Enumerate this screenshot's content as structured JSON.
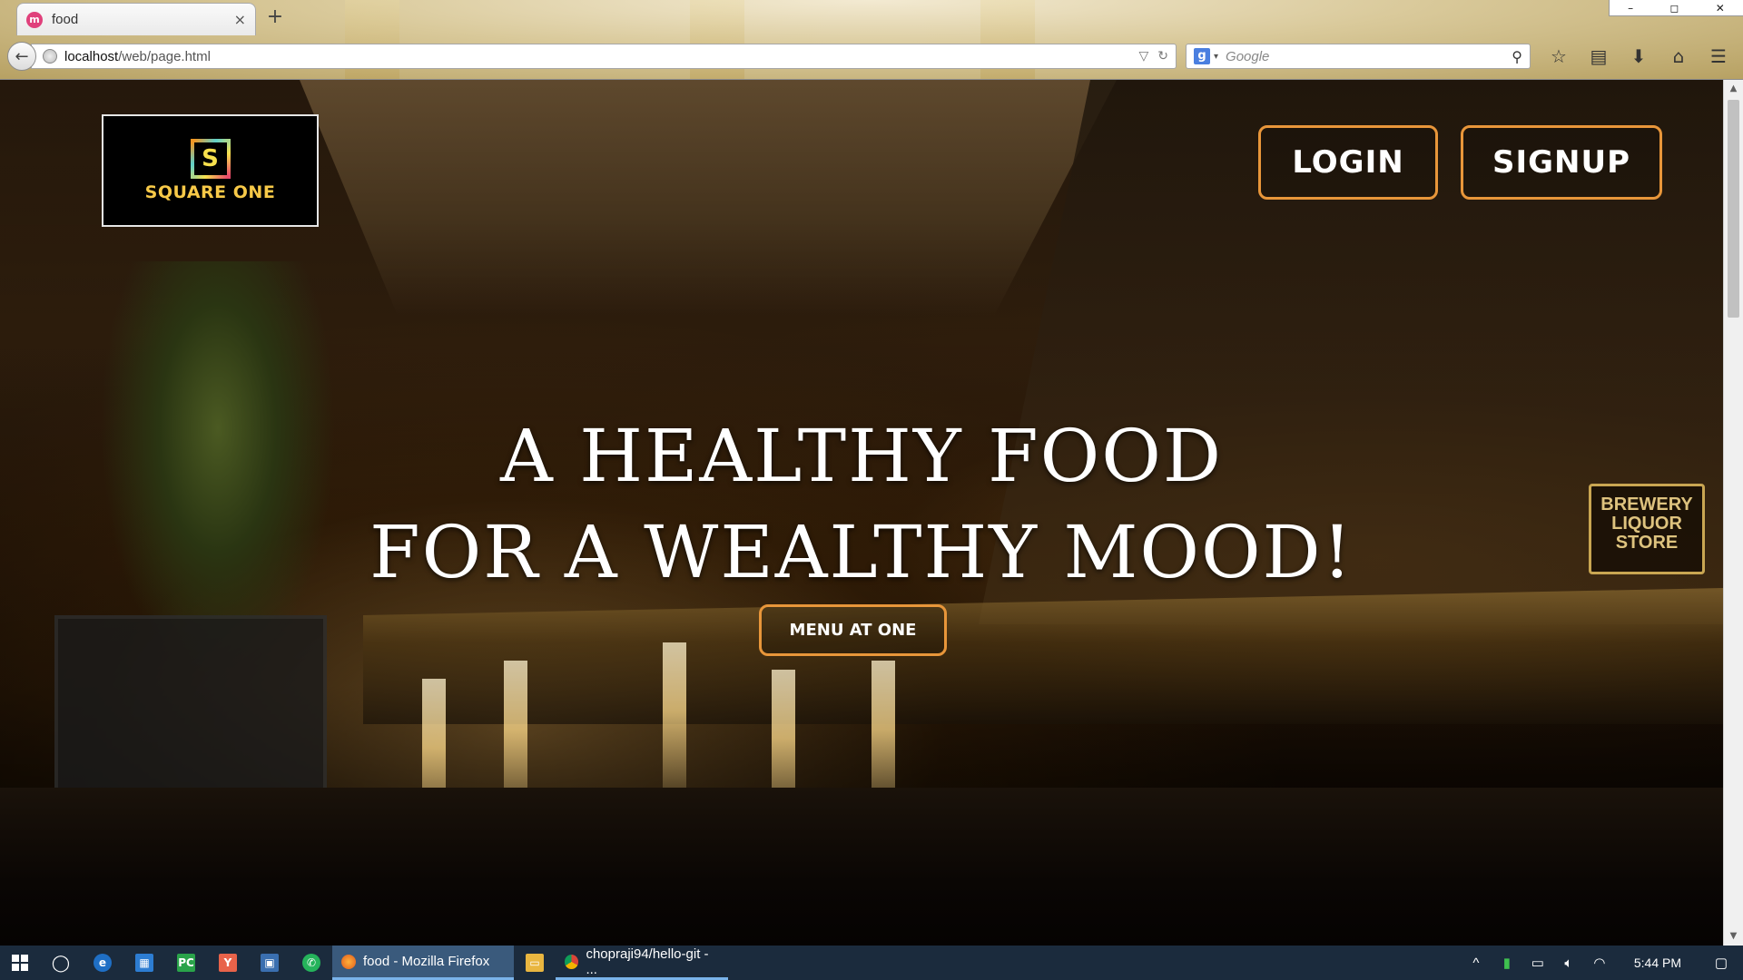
{
  "browser": {
    "tab_title": "food",
    "tab_favicon_glyph": "m",
    "close_glyph": "×",
    "new_tab_glyph": "+",
    "window_controls": [
      "–",
      "◻",
      "✕"
    ],
    "url_host": "localhost",
    "url_path": "/web/page.html",
    "search_engine_glyph": "g",
    "search_placeholder": "Google",
    "icons": {
      "back": "back-arrow-icon",
      "bookmark": "star-icon",
      "library": "reading-list-icon",
      "downloads": "download-icon",
      "home": "home-icon",
      "menu": "hamburger-menu-icon"
    }
  },
  "page": {
    "logo_mark": "S",
    "logo_text": "SQUARE ONE",
    "login_label": "LOGIN",
    "signup_label": "SIGNUP",
    "hero_line_1": "A HEALTHY FOOD",
    "hero_line_2": "FOR A WEALTHY MOOD!",
    "menu_button_label": "MENU AT ONE",
    "background_sign": "BREWERY LIQUOR STORE",
    "accent_color": "#e8963a"
  },
  "taskbar": {
    "apps": [
      "cortana-icon",
      "edge-icon",
      "store-icon",
      "pycharm-icon",
      "yandex-icon",
      "app-icon",
      "whatsapp-icon"
    ],
    "active_task": "food - Mozilla Firefox",
    "second_task": "chopraji94/hello-git - ...",
    "clock": "5:44 PM"
  }
}
